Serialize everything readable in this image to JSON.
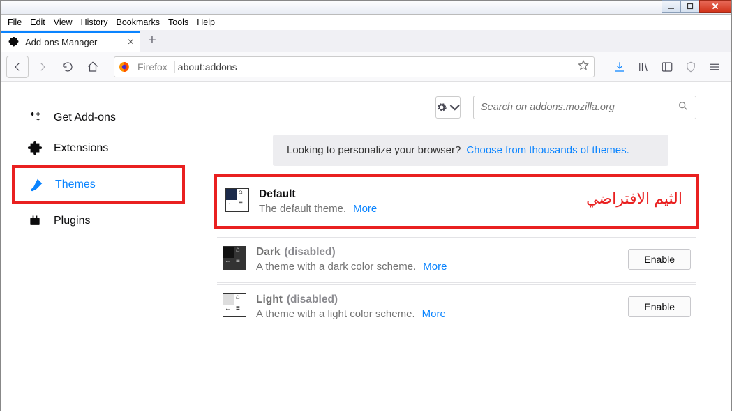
{
  "menubar": {
    "items": [
      "File",
      "Edit",
      "View",
      "History",
      "Bookmarks",
      "Tools",
      "Help"
    ]
  },
  "tab": {
    "title": "Add-ons Manager"
  },
  "urlbar": {
    "identity_label": "Firefox",
    "url": "about:addons"
  },
  "sidebar": {
    "items": [
      {
        "label": "Get Add-ons"
      },
      {
        "label": "Extensions"
      },
      {
        "label": "Themes"
      },
      {
        "label": "Plugins"
      }
    ]
  },
  "toolbar": {
    "search_placeholder": "Search on addons.mozilla.org"
  },
  "banner": {
    "text": "Looking to personalize your browser?",
    "link": "Choose from thousands of themes."
  },
  "annotation": {
    "text": "الثيم الافتراضي"
  },
  "themes": [
    {
      "name": "Default",
      "desc": "The default theme.",
      "more": "More",
      "disabled": false
    },
    {
      "name": "Dark",
      "desc": "A theme with a dark color scheme.",
      "more": "More",
      "disabled": true,
      "disabled_tag": "(disabled)",
      "action": "Enable"
    },
    {
      "name": "Light",
      "desc": "A theme with a light color scheme.",
      "more": "More",
      "disabled": true,
      "disabled_tag": "(disabled)",
      "action": "Enable"
    }
  ]
}
